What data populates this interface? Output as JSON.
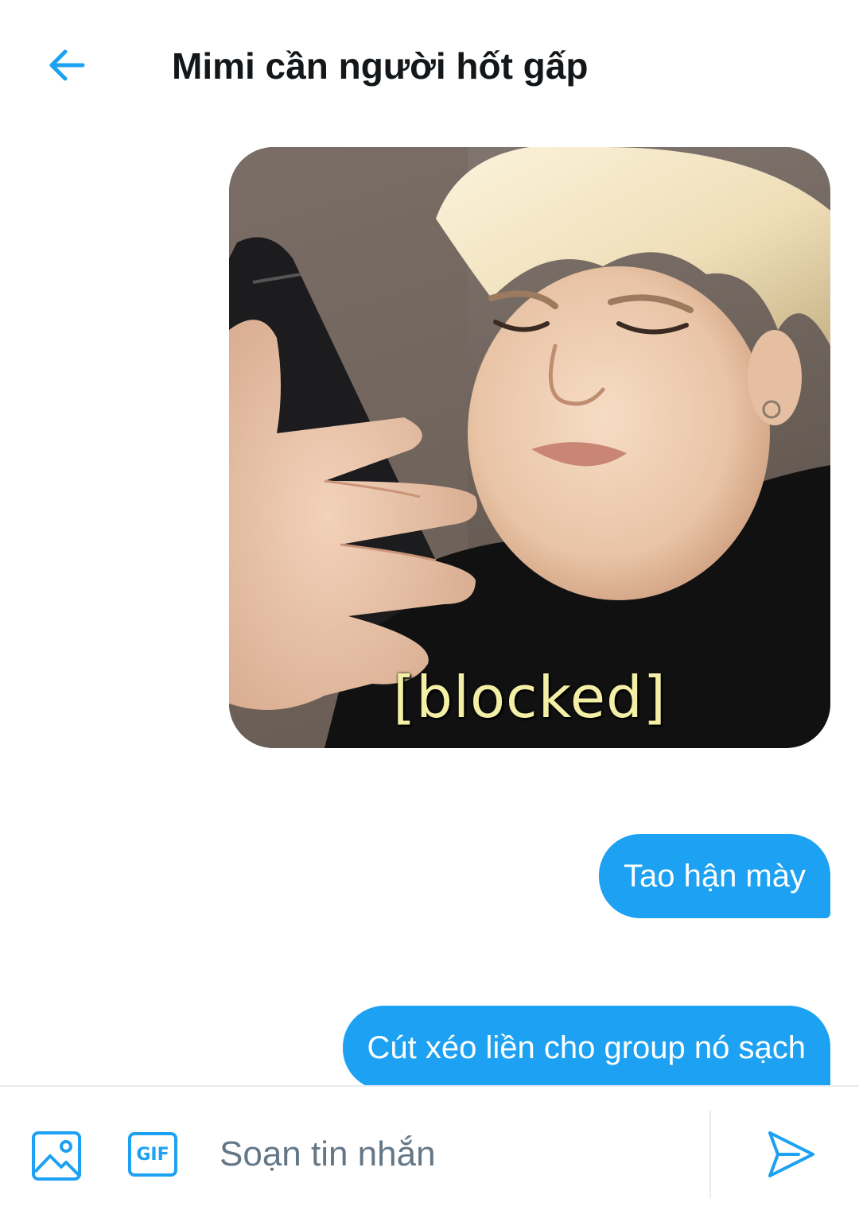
{
  "header": {
    "title": "Mimi cần người hốt gấp",
    "back_icon": "arrow-left-icon"
  },
  "messages": [
    {
      "type": "image",
      "caption": "[blocked]"
    },
    {
      "type": "text",
      "text": "Tao hận mày"
    },
    {
      "type": "text",
      "text": "Cút xéo liền cho group nó sạch"
    }
  ],
  "composer": {
    "placeholder": "Soạn tin nhắn",
    "value": "",
    "image_icon": "image-icon",
    "gif_label": "GIF",
    "send_icon": "send-icon"
  },
  "colors": {
    "accent": "#1da1f2",
    "title_text": "#14171a",
    "placeholder_text": "#657786",
    "divider": "#e6ecf0"
  }
}
